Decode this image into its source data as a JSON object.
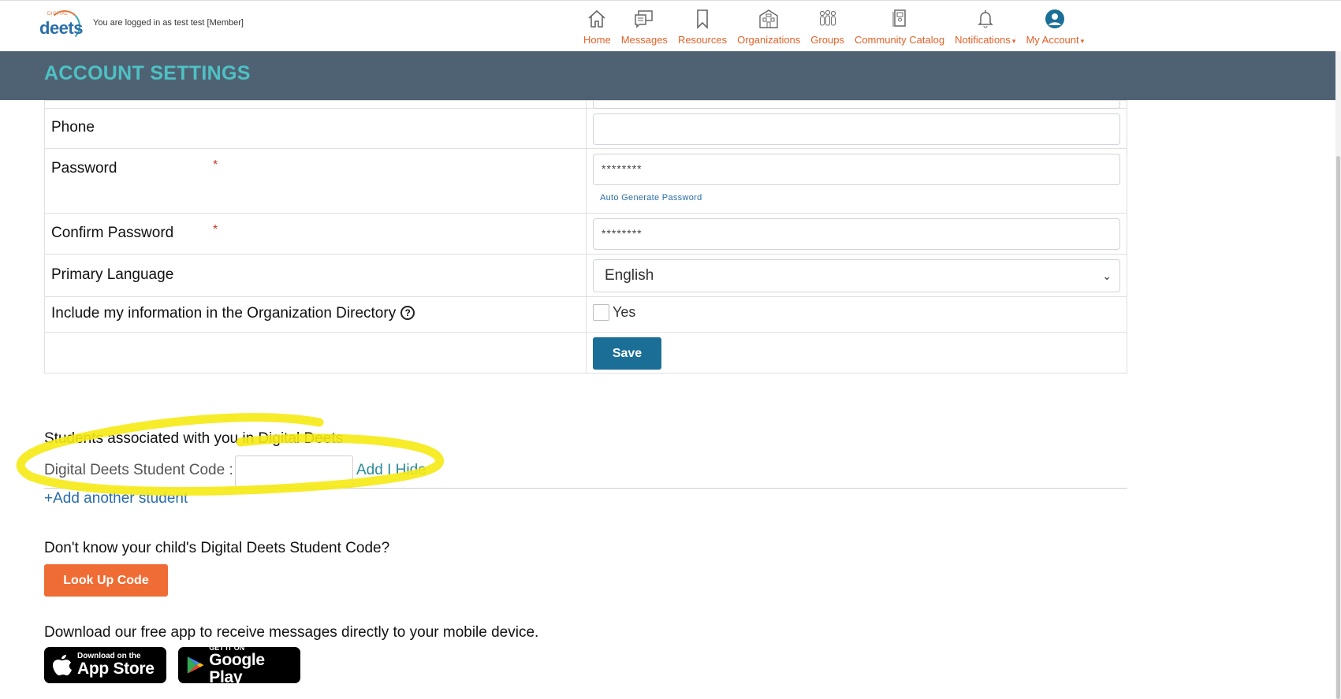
{
  "header": {
    "logo": {
      "small": "DIGITAL",
      "big": "deets"
    },
    "logged_in_text": "You are logged in as test test [Member]",
    "nav": [
      {
        "label": "Home",
        "icon": "home-icon"
      },
      {
        "label": "Messages",
        "icon": "messages-icon"
      },
      {
        "label": "Resources",
        "icon": "bookmark-icon"
      },
      {
        "label": "Organizations",
        "icon": "building-icon"
      },
      {
        "label": "Groups",
        "icon": "groups-icon"
      },
      {
        "label": "Community Catalog",
        "icon": "catalog-icon"
      },
      {
        "label": "Notifications",
        "icon": "bell-icon",
        "caret": "▾"
      },
      {
        "label": "My Account",
        "icon": "user-icon",
        "caret": "▾"
      }
    ],
    "accent_color": "#e0622a"
  },
  "page_title": "ACCOUNT SETTINGS",
  "form": {
    "phone_label": "Phone",
    "phone_value": "",
    "password_label": "Password",
    "password_value": "********",
    "required_mark": "*",
    "auto_generate_label": "Auto Generate Password",
    "confirm_password_label": "Confirm Password",
    "confirm_password_value": "********",
    "primary_language_label": "Primary Language",
    "primary_language_value": "English",
    "directory_label": "Include my information in the Organization Directory",
    "directory_checkbox_label": "Yes",
    "directory_checked": false,
    "save_label": "Save"
  },
  "students": {
    "title": "Students associated with you in Digital Deets",
    "code_label": "Digital Deets Student Code :",
    "code_value": "",
    "add_hide_label": "Add I Hide",
    "add_another_label": "+Add another student",
    "dont_know_text": "Don't know your child's Digital Deets Student Code?",
    "lookup_label": "Look Up Code"
  },
  "download": {
    "text": "Download our free app to receive messages directly to your mobile device.",
    "appstore_top": "Download on the",
    "appstore_bottom": "App Store",
    "gplay_top": "GET IT ON",
    "gplay_bottom": "Google Play"
  },
  "colors": {
    "band": "#4f6274",
    "title": "#4ec1c3",
    "save_button": "#1b6f97",
    "lookup_button": "#ef6c34",
    "highlight": "#f5ea13"
  }
}
